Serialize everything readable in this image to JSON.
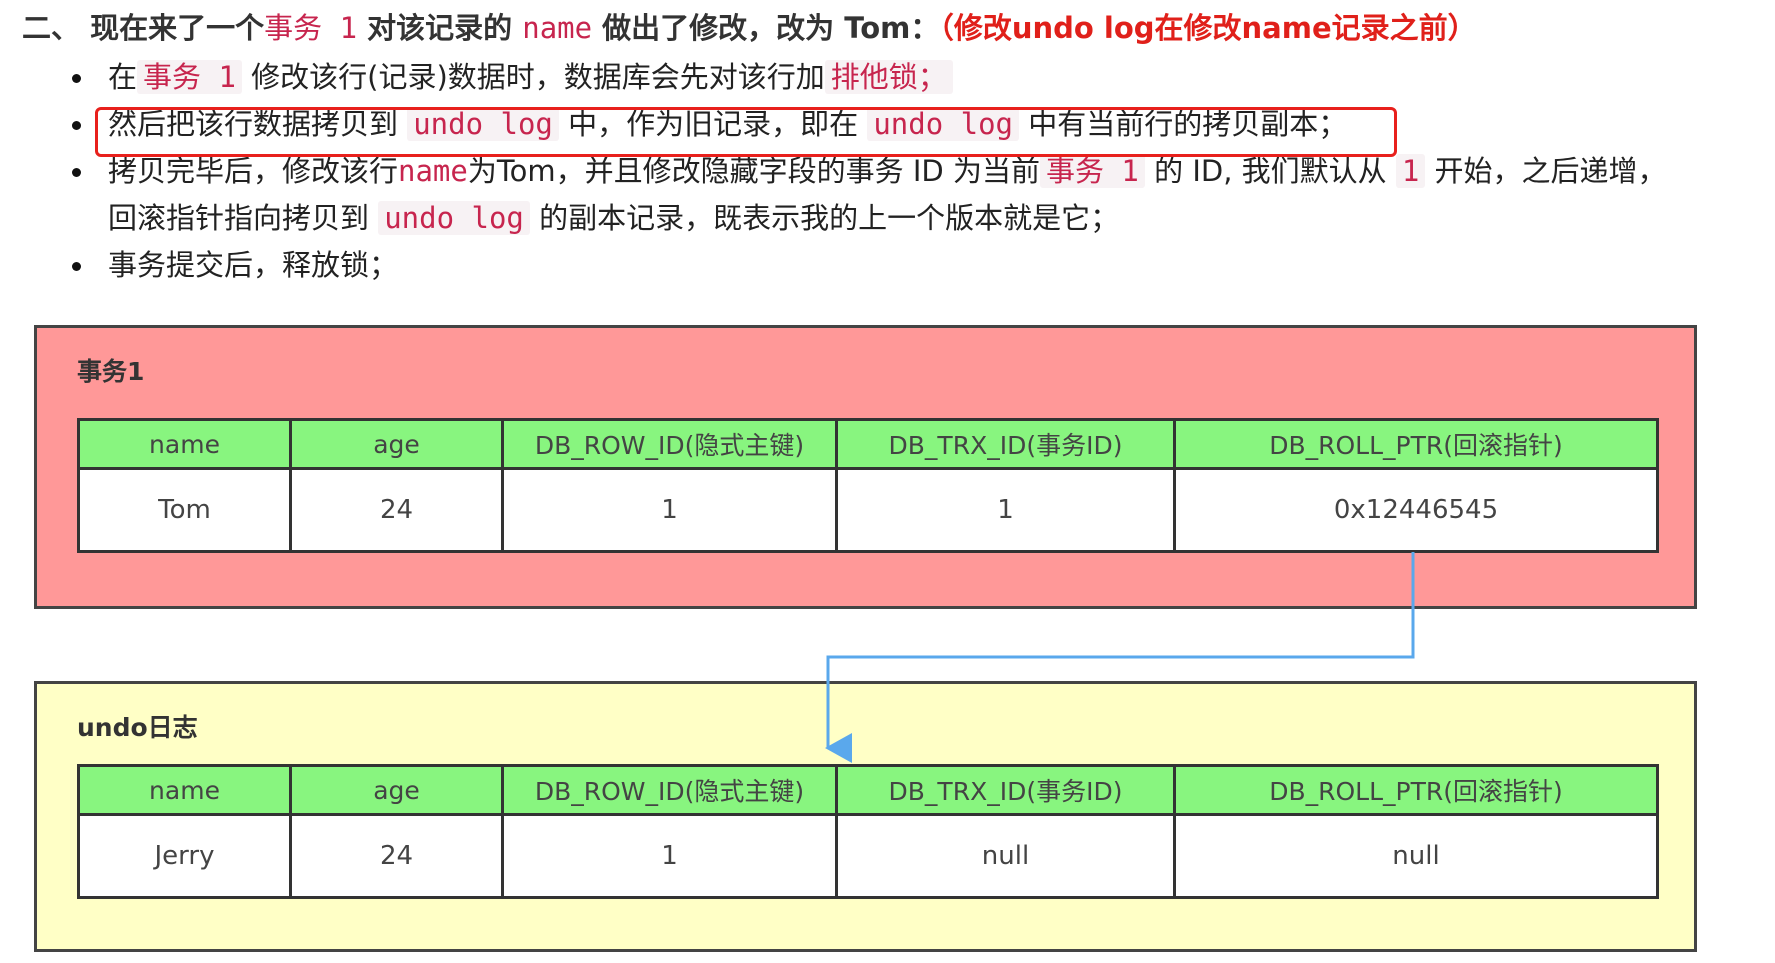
{
  "heading": {
    "prefix": "二、 现在来了一个",
    "code1": "事务 1",
    "mid1": " 对该记录的 ",
    "code2": "name",
    "mid2": " 做出了修改，改为 Tom：",
    "note": "（修改undo log在修改name记录之前）"
  },
  "bullets": [
    {
      "a": "在",
      "code1": "事务 1",
      "b": " 修改该行(记录)数据时，数据库会先对该行加",
      "code2": "排他锁；"
    },
    {
      "a": "然后把该行数据拷贝到 ",
      "code1": "undo log",
      "b": " 中，作为旧记录，即在 ",
      "code2": "undo log",
      "c": " 中有当前行的拷贝副本；"
    },
    {
      "a": "拷贝完毕后，修改该行",
      "code1": "name",
      "b": "为Tom，并且修改隐藏字段的事务 ID 为当前",
      "code2": "事务 1",
      "c": " 的 ID, 我们默认从 ",
      "code3": "1",
      "d": " 开始，之后递增，",
      "line2a": "回滚指针指向拷贝到 ",
      "code4": "undo log",
      "line2b": " 的副本记录，既表示我的上一个版本就是它；"
    },
    {
      "a": "事务提交后，释放锁；"
    }
  ],
  "transaction_panel": {
    "title": "事务1",
    "headers": [
      "name",
      "age",
      "DB_ROW_ID(隐式主键)",
      "DB_TRX_ID(事务ID)",
      "DB_ROLL_PTR(回滚指针)"
    ],
    "row": [
      "Tom",
      "24",
      "1",
      "1",
      "0x12446545"
    ]
  },
  "undo_panel": {
    "title": "undo日志",
    "headers": [
      "name",
      "age",
      "DB_ROW_ID(隐式主键)",
      "DB_TRX_ID(事务ID)",
      "DB_ROLL_PTR(回滚指针)"
    ],
    "row": [
      "Jerry",
      "24",
      "1",
      "null",
      "null"
    ]
  },
  "colors": {
    "accent_red": "#e0201a",
    "code_text": "#c7254e",
    "transaction_bg": "#ff9898",
    "undo_bg": "#ffffc6",
    "header_green": "#88f57f",
    "arrow_blue": "#5aa8ec"
  }
}
